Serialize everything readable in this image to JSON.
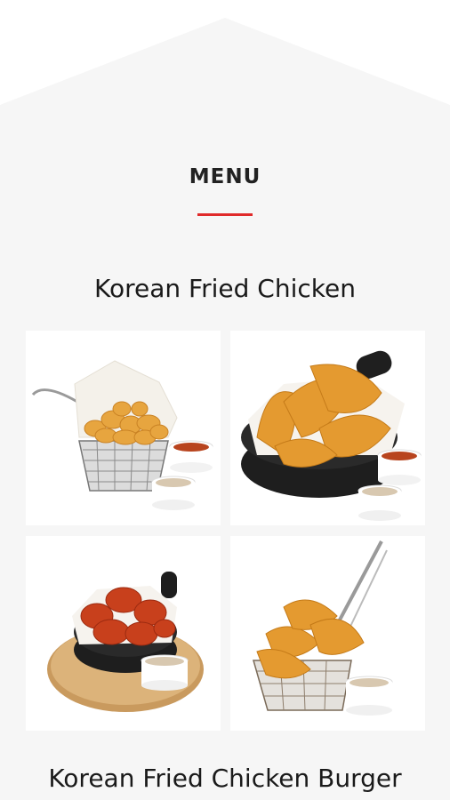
{
  "menu": {
    "title": "MENU",
    "accent_color": "#e02a2a"
  },
  "sections": [
    {
      "heading": "Korean Fried Chicken",
      "items": [
        {
          "icon": "fried-chicken-basket-image"
        },
        {
          "icon": "fried-chicken-tenders-pan-image"
        },
        {
          "icon": "sauced-chicken-wings-board-image"
        },
        {
          "icon": "chicken-strips-fry-basket-image"
        }
      ]
    },
    {
      "heading": "Korean Fried Chicken Burger"
    }
  ]
}
